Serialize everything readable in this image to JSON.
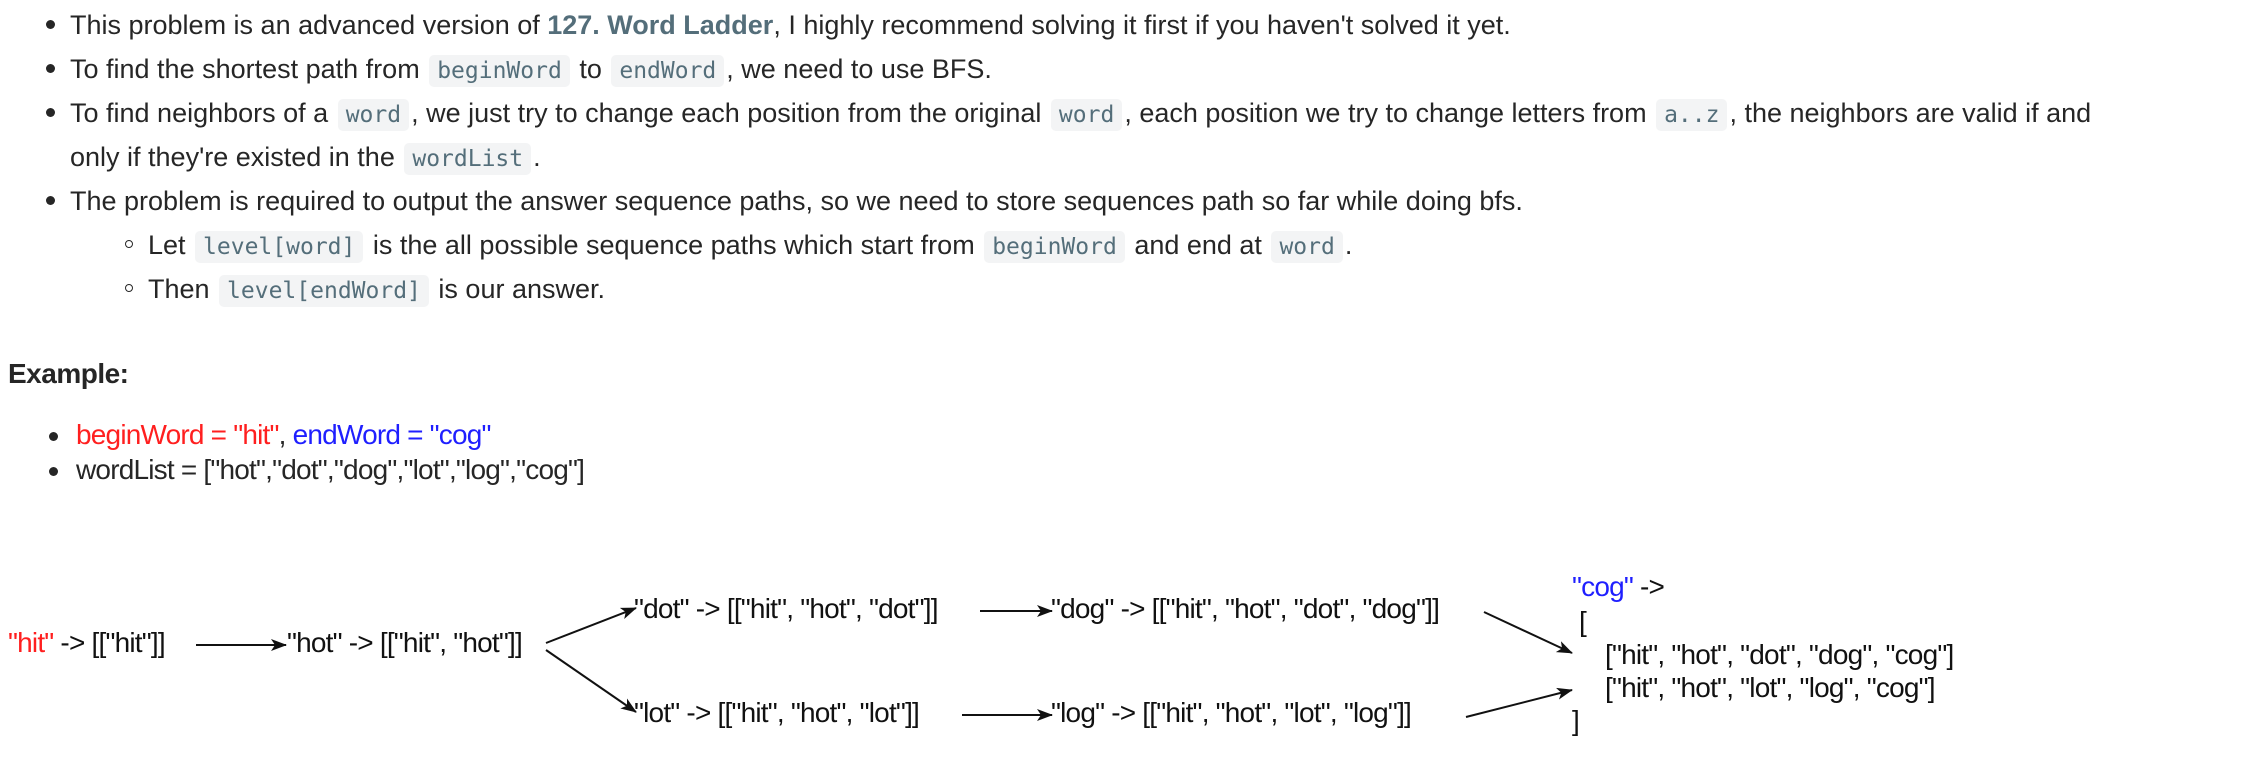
{
  "bullets": {
    "b1": {
      "pre": "This problem is an advanced version of ",
      "link": "127. Word Ladder",
      "post": ", I highly recommend solving it first if you haven't solved it yet."
    },
    "b2": {
      "t1": "To find the shortest path from ",
      "c1": "beginWord",
      "t2": " to ",
      "c2": "endWord",
      "t3": ", we need to use BFS."
    },
    "b3": {
      "t1": "To find neighbors of a ",
      "c1": "word",
      "t2": ", we just try to change each position from the original ",
      "c2": "word",
      "t3": ", each position we try to change letters from ",
      "c3": "a..z",
      "t4": ", the neighbors are valid if and",
      "l2t1": "only if they're existed in the ",
      "l2c1": "wordList",
      "l2t2": "."
    },
    "b4": {
      "text": "The problem is required to output the answer sequence paths, so we need to store sequences path so far while doing bfs."
    },
    "s1": {
      "t1": "Let ",
      "c1": "level[word]",
      "t2": " is the all possible sequence paths which start from ",
      "c2": "beginWord",
      "t3": " and end at ",
      "c3": "word",
      "t4": "."
    },
    "s2": {
      "t1": "Then ",
      "c1": "level[endWord]",
      "t2": " is our answer."
    }
  },
  "example": {
    "title": "Example:",
    "line1": {
      "begin": "beginWord = \"hit\"",
      "sep": ", ",
      "end": "endWord = \"cog\""
    },
    "line2": "wordList = [\"hot\",\"dot\",\"dog\",\"lot\",\"log\",\"cog\"]"
  },
  "diagram": {
    "n_hit_word": "\"hit\"",
    "n_hit_rest": " -> [[\"hit\"]]",
    "n_hot": "\"hot\" -> [[\"hit\", \"hot\"]]",
    "n_dot": "\"dot\" -> [[\"hit\", \"hot\", \"dot\"]]",
    "n_dog": "\"dog\" -> [[\"hit\", \"hot\", \"dot\", \"dog\"]]",
    "n_lot": "\"lot\" -> [[\"hit\", \"hot\", \"lot\"]]",
    "n_log": "\"log\" -> [[\"hit\", \"hot\", \"lot\", \"log\"]]",
    "n_cog_word": "\"cog\"",
    "n_cog_rest": " ->",
    "open_bracket": "[",
    "path1": "[\"hit\", \"hot\", \"dot\", \"dog\", \"cog\"]",
    "path2": "[\"hit\", \"hot\", \"lot\", \"log\", \"cog\"]",
    "close_bracket": "]"
  },
  "colors": {
    "red": "#ff1f1f",
    "blue": "#1f1fff",
    "code_text": "#546e7a",
    "code_bg": "#f3f4f5"
  }
}
